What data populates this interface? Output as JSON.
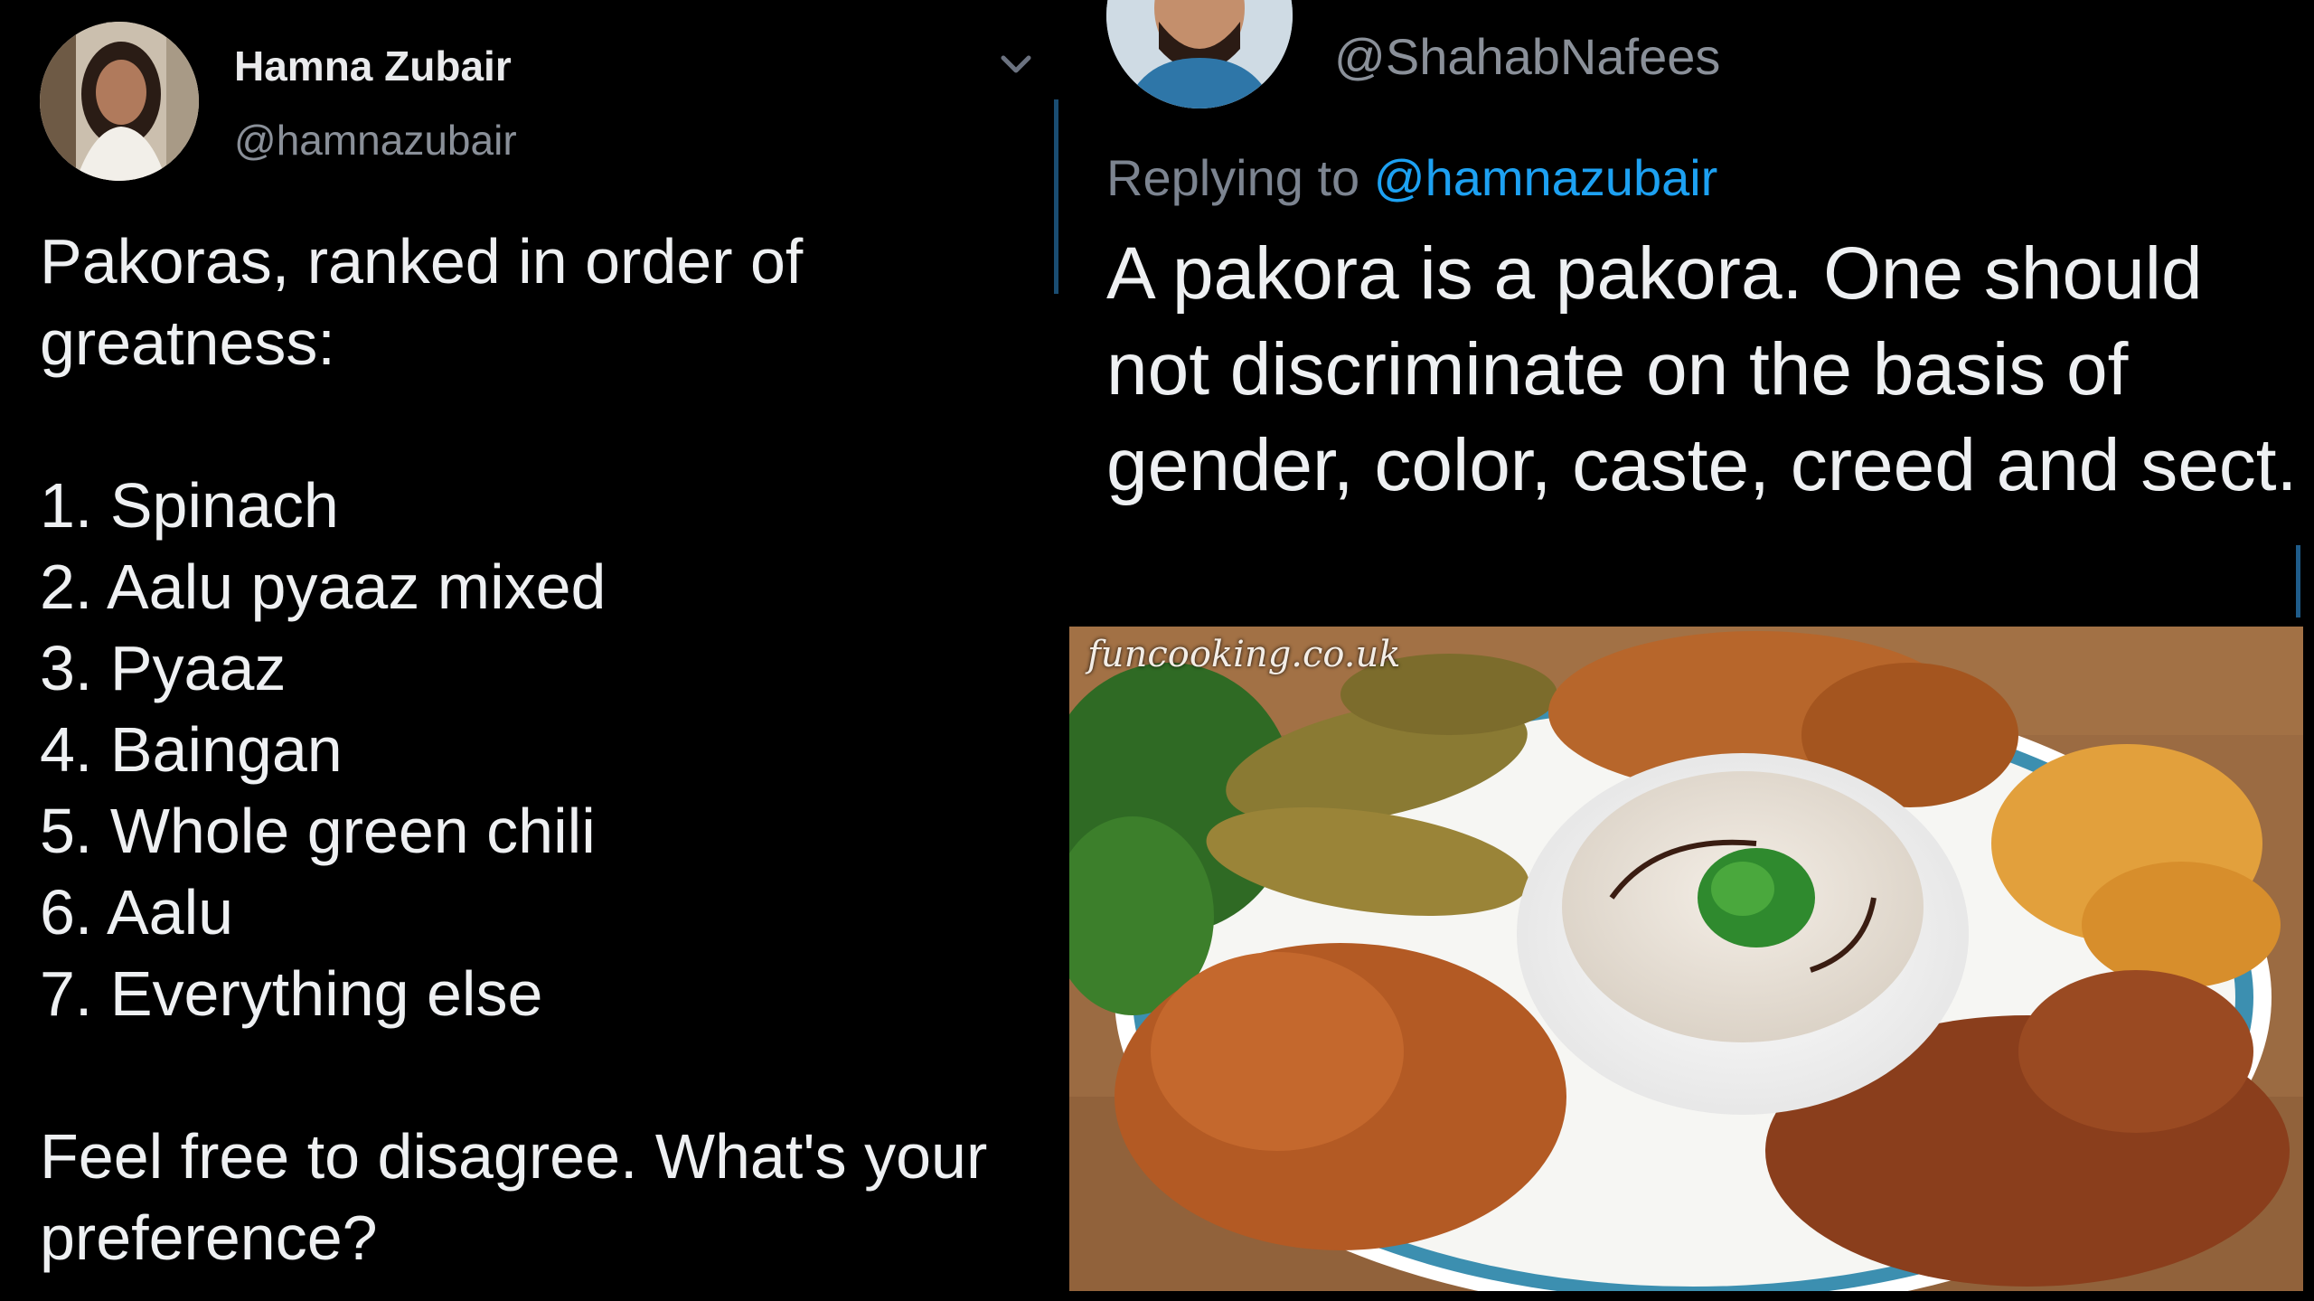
{
  "left_tweet": {
    "display_name": "Hamna Zubair",
    "handle": "@hamnazubair",
    "menu_icon": "chevron-down-icon",
    "text": "Pakoras, ranked in order of\ngreatness:\n\n1. Spinach\n2. Aalu pyaaz mixed\n3. Pyaaz\n4. Baingan\n5. Whole green chili\n6. Aalu\n7. Everything else\n\nFeel free to disagree. What's your\npreference?"
  },
  "right_tweet": {
    "handle": "@ShahabNafees",
    "replying_prefix": "Replying to",
    "replying_to": "@hamnazubair",
    "text": "A pakora is a pakora. One should not discriminate on the basis of gender, color, caste, creed and sect.",
    "image_watermark": "funcooking.co.uk"
  },
  "colors": {
    "background": "#000000",
    "link": "#1da1f2",
    "secondary_text": "#8a9099",
    "thread_line": "#1a4d72"
  }
}
